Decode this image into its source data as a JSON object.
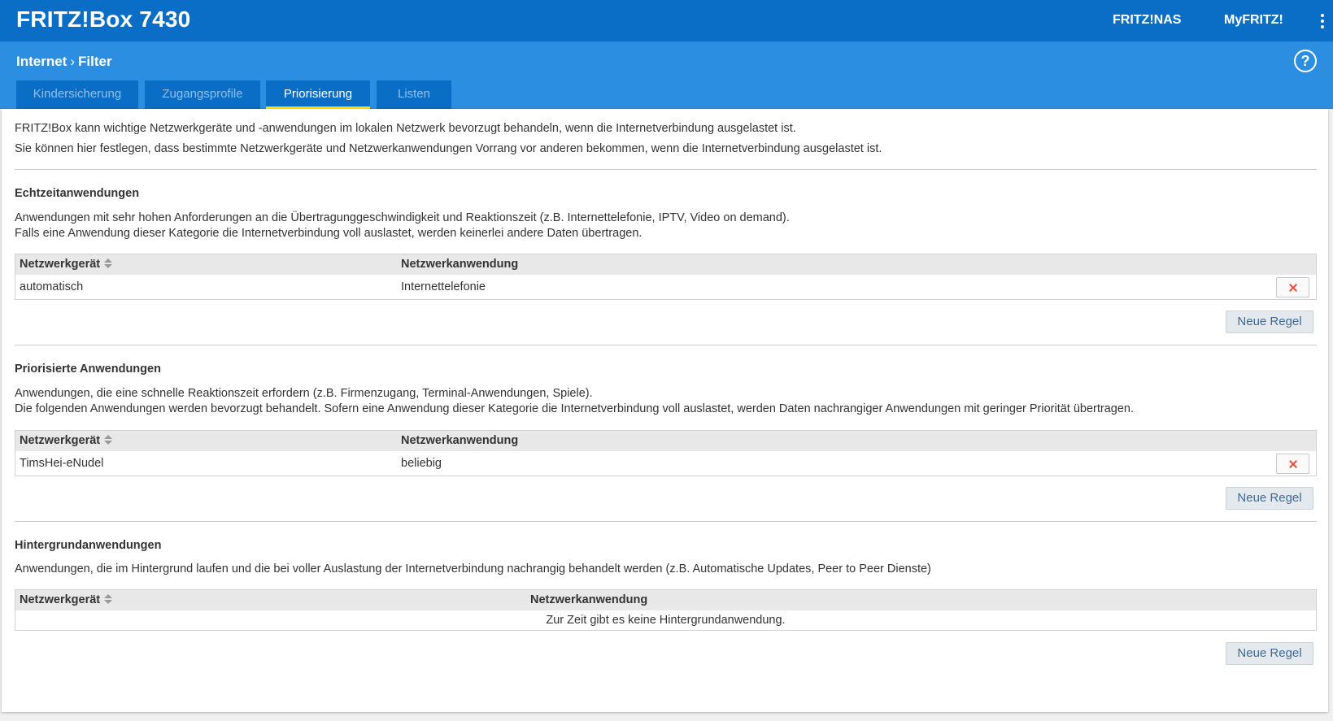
{
  "header": {
    "brand": "FRITZ!Box 7430",
    "nav": [
      "FRITZ!NAS",
      "MyFRITZ!"
    ]
  },
  "subheader": {
    "breadcrumb": [
      "Internet",
      "Filter"
    ],
    "help": "?",
    "tabs": [
      "Kindersicherung",
      "Zugangsprofile",
      "Priorisierung",
      "Listen"
    ],
    "active_tab": "Priorisierung"
  },
  "intro": [
    "FRITZ!Box kann wichtige Netzwerkgeräte und -anwendungen im lokalen Netzwerk bevorzugt behandeln, wenn die Internetverbindung ausgelastet ist.",
    "Sie können hier festlegen, dass bestimmte Netzwerkgeräte und Netzwerkanwendungen Vorrang vor anderen bekommen, wenn die Internetverbindung ausgelastet ist."
  ],
  "sections": [
    {
      "title": "Echtzeitanwendungen",
      "desc": [
        "Anwendungen mit sehr hohen Anforderungen an die Übertragunggeschwindigkeit und Reaktionszeit (z.B. Internettelefonie, IPTV, Video on demand).",
        "Falls eine Anwendung dieser Kategorie die Internetverbindung voll auslastet, werden keinerlei andere Daten übertragen."
      ],
      "columns": [
        "Netzwerkgerät",
        "Netzwerkanwendung"
      ],
      "rows": [
        {
          "device": "automatisch",
          "app": "Internettelefonie"
        }
      ],
      "button": "Neue Regel"
    },
    {
      "title": "Priorisierte Anwendungen",
      "desc": [
        "Anwendungen, die eine schnelle Reaktionszeit erfordern (z.B. Firmenzugang, Terminal-Anwendungen, Spiele).",
        "Die folgenden Anwendungen werden bevorzugt behandelt. Sofern eine Anwendung dieser Kategorie die Internetverbindung voll auslastet, werden Daten nachrangiger Anwendungen mit geringer Priorität übertragen."
      ],
      "columns": [
        "Netzwerkgerät",
        "Netzwerkanwendung"
      ],
      "rows": [
        {
          "device": "TimsHei-eNudel",
          "app": "beliebig"
        }
      ],
      "button": "Neue Regel"
    },
    {
      "title": "Hintergrundanwendungen",
      "desc": [
        "Anwendungen, die im Hintergrund laufen und die bei voller Auslastung der Internetverbindung nachrangig behandelt werden (z.B. Automatische Updates, Peer to Peer Dienste)"
      ],
      "columns": [
        "Netzwerkgerät",
        "Netzwerkanwendung"
      ],
      "empty": "Zur Zeit gibt es keine Hintergrundanwendung.",
      "button": "Neue Regel"
    }
  ],
  "colors": {
    "topbar": "#0a6ec6",
    "subbar": "#2b8ee1",
    "active_tab_underline": "#ffe400",
    "delete_icon": "#e5533a"
  }
}
